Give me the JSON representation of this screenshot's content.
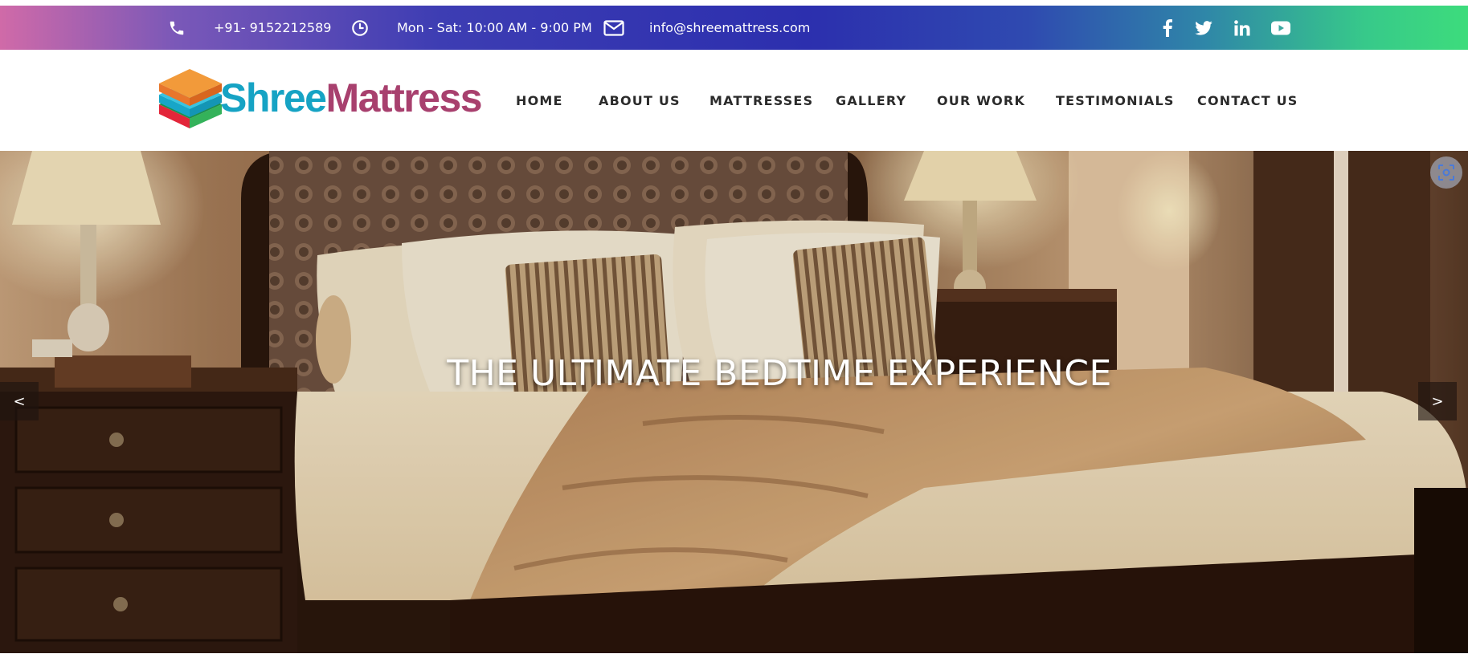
{
  "topbar": {
    "phone": "+91- 9152212589",
    "hours": "Mon - Sat: 10:00 AM - 9:00 PM",
    "email": "info@shreemattress.com",
    "icons": {
      "phone": "phone-icon",
      "clock": "clock-icon",
      "mail": "mail-icon"
    },
    "social": [
      "facebook-icon",
      "twitter-icon",
      "linkedin-icon",
      "youtube-icon"
    ]
  },
  "logo": {
    "part1": "Shree",
    "part2": "Mattress"
  },
  "nav": {
    "items": [
      {
        "label": "HOME"
      },
      {
        "label": "ABOUT US"
      },
      {
        "label": "MATTRESSES"
      },
      {
        "label": "GALLERY"
      },
      {
        "label": "OUR WORK"
      },
      {
        "label": "TESTIMONIALS"
      },
      {
        "label": "CONTACT US"
      }
    ]
  },
  "hero": {
    "title": "THE ULTIMATE BEDTIME EXPERIENCE",
    "prev": "<",
    "next": ">"
  },
  "colors": {
    "gradient_start": "#d06aa8",
    "gradient_mid": "#2c2fae",
    "gradient_end": "#3ddc7c",
    "logo_shree": "#16a3c4",
    "logo_mattress": "#a8406e",
    "nav_text": "#2b2b2b"
  }
}
